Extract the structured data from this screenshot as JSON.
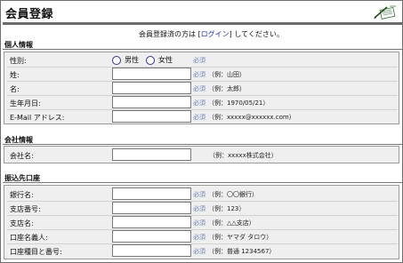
{
  "page": {
    "title": "会員登録",
    "logo_icon": "pen-and-paper-icon"
  },
  "login_notice": {
    "before": "会員登録済の方は ",
    "bracket_open": "[",
    "link_label": "ログイン",
    "bracket_close": "]",
    "after": " してください。"
  },
  "personal": {
    "heading": "個人情報",
    "gender": {
      "label": "性別:",
      "options": [
        "男性",
        "女性"
      ],
      "required": "必須"
    },
    "rows": [
      {
        "label": "姓:",
        "value": "",
        "required": "必須",
        "example": "（例：山田）"
      },
      {
        "label": "名:",
        "value": "",
        "required": "必須",
        "example": "（例：太郎）"
      },
      {
        "label": "生年月日:",
        "value": "",
        "required": "必須",
        "example": "（例：1970/05/21）"
      },
      {
        "label": "E-Mail アドレス:",
        "value": "",
        "required": "必須",
        "example": "（例：xxxxx@xxxxxx.com）"
      }
    ]
  },
  "company": {
    "heading": "会社情報",
    "rows": [
      {
        "label": "会社名:",
        "value": "",
        "required": "",
        "example": "（例：xxxxx株式会社）"
      }
    ]
  },
  "bank": {
    "heading": "振込先口座",
    "rows": [
      {
        "label": "銀行名:",
        "value": "",
        "required": "必須",
        "example": "（例：〇〇銀行）"
      },
      {
        "label": "支店番号:",
        "value": "",
        "required": "必須",
        "example": "（例：123）"
      },
      {
        "label": "支店名:",
        "value": "",
        "required": "必須",
        "example": "（例：△△支店）"
      },
      {
        "label": "口座名義人:",
        "value": "",
        "required": "必須",
        "example": "（例：ヤマダ タロウ）"
      },
      {
        "label": "口座種目と番号:",
        "value": "",
        "required": "必須",
        "example": "（例：普通 1234567）"
      }
    ]
  },
  "colors": {
    "link": "#1a33a8",
    "required": "#7080b8",
    "panel": "#efefef",
    "rule": "#6b6b6b"
  }
}
